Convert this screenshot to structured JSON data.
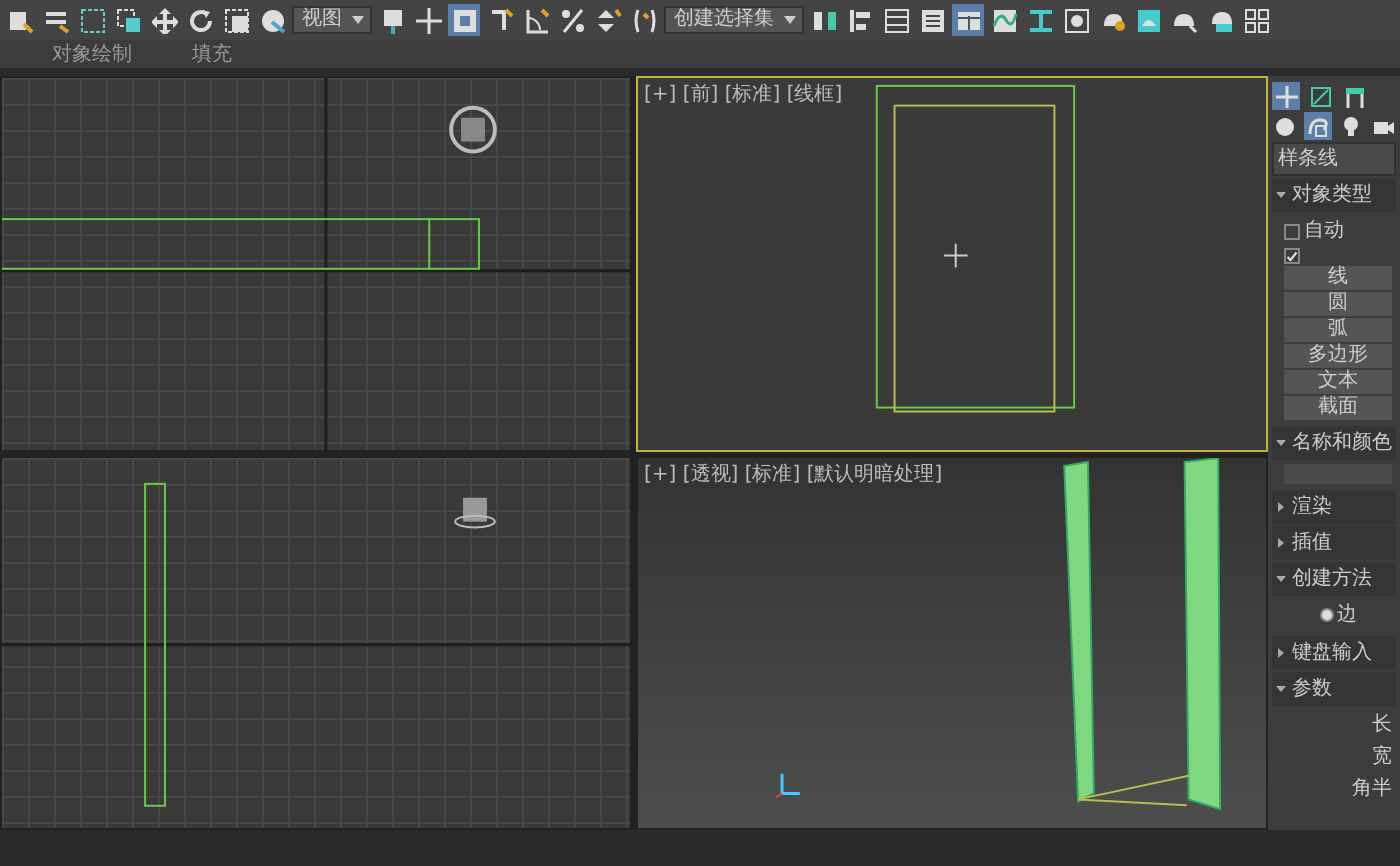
{
  "toolbar": {
    "buttons": [
      {
        "kind": "link",
        "selected": false
      },
      {
        "kind": "unlink",
        "selected": false
      },
      {
        "kind": "select-region",
        "selected": false
      },
      {
        "kind": "select-window",
        "selected": false
      },
      {
        "kind": "move",
        "selected": false
      },
      {
        "kind": "rotate",
        "selected": false
      },
      {
        "kind": "scale",
        "selected": false
      },
      {
        "kind": "place",
        "selected": false
      }
    ],
    "view_dropdown": "视图",
    "buttons_2": [
      {
        "kind": "pivot",
        "selected": false
      },
      {
        "kind": "crosshair",
        "selected": false
      },
      {
        "kind": "snap-toggle",
        "selected": true
      },
      {
        "kind": "snap",
        "selected": false
      },
      {
        "kind": "angle-snap",
        "selected": false
      },
      {
        "kind": "percent-snap",
        "selected": false
      },
      {
        "kind": "spinner-snap",
        "selected": false
      },
      {
        "kind": "named-set",
        "selected": false
      }
    ],
    "selection_set_dropdown": "创建选择集",
    "buttons_3": [
      {
        "kind": "mirror",
        "selected": false
      },
      {
        "kind": "align",
        "selected": false
      },
      {
        "kind": "layers",
        "selected": false
      },
      {
        "kind": "layer-explorer",
        "selected": false
      },
      {
        "kind": "ribbon",
        "selected": true
      },
      {
        "kind": "curve-editor",
        "selected": false
      },
      {
        "kind": "schematic",
        "selected": false
      },
      {
        "kind": "material",
        "selected": false
      },
      {
        "kind": "render-setup",
        "selected": false
      },
      {
        "kind": "render-frame",
        "selected": false
      },
      {
        "kind": "render",
        "selected": false
      },
      {
        "kind": "render-cloud",
        "selected": false
      },
      {
        "kind": "grid-panel",
        "selected": false
      }
    ]
  },
  "ribbon": {
    "labels": [
      "对象绘制",
      "填充"
    ]
  },
  "viewports": [
    {
      "kind": "top",
      "active": false
    },
    {
      "kind": "front",
      "active": true,
      "label": "[+] [前] [标准] [线框]"
    },
    {
      "kind": "left",
      "active": false
    },
    {
      "kind": "perspective",
      "active": false,
      "label": "[+] [透视] [标准] [默认明暗处理]"
    }
  ],
  "command_panel": {
    "tabs": [
      {
        "kind": "create",
        "selected": true
      },
      {
        "kind": "modify",
        "selected": false
      },
      {
        "kind": "hierarchy",
        "selected": false
      }
    ],
    "categories": [
      {
        "kind": "geometry",
        "selected": false
      },
      {
        "kind": "shapes",
        "selected": true
      },
      {
        "kind": "lights",
        "selected": false
      },
      {
        "kind": "cameras",
        "selected": false
      }
    ],
    "category_dropdown": "样条线",
    "object_type": {
      "title": "对象类型",
      "expanded": true,
      "autogrid": {
        "label": "自动",
        "checked": false
      },
      "start_new_shape": {
        "checked": true
      },
      "buttons": [
        "线",
        "圆",
        "弧",
        "多边形",
        "文本",
        "截面"
      ]
    },
    "name_and_color": {
      "title": "名称和颜色",
      "expanded": true
    },
    "rollouts": [
      {
        "title": "渲染",
        "expanded": false
      },
      {
        "title": "插值",
        "expanded": false
      }
    ],
    "creation_method": {
      "title": "创建方法",
      "expanded": true,
      "options": [
        {
          "label": "边",
          "selected": true
        }
      ]
    },
    "rollouts_2": [
      {
        "title": "键盘输入",
        "expanded": false
      }
    ],
    "parameters": {
      "title": "参数",
      "expanded": true,
      "fields": [
        "长",
        "宽",
        "角半"
      ]
    }
  }
}
